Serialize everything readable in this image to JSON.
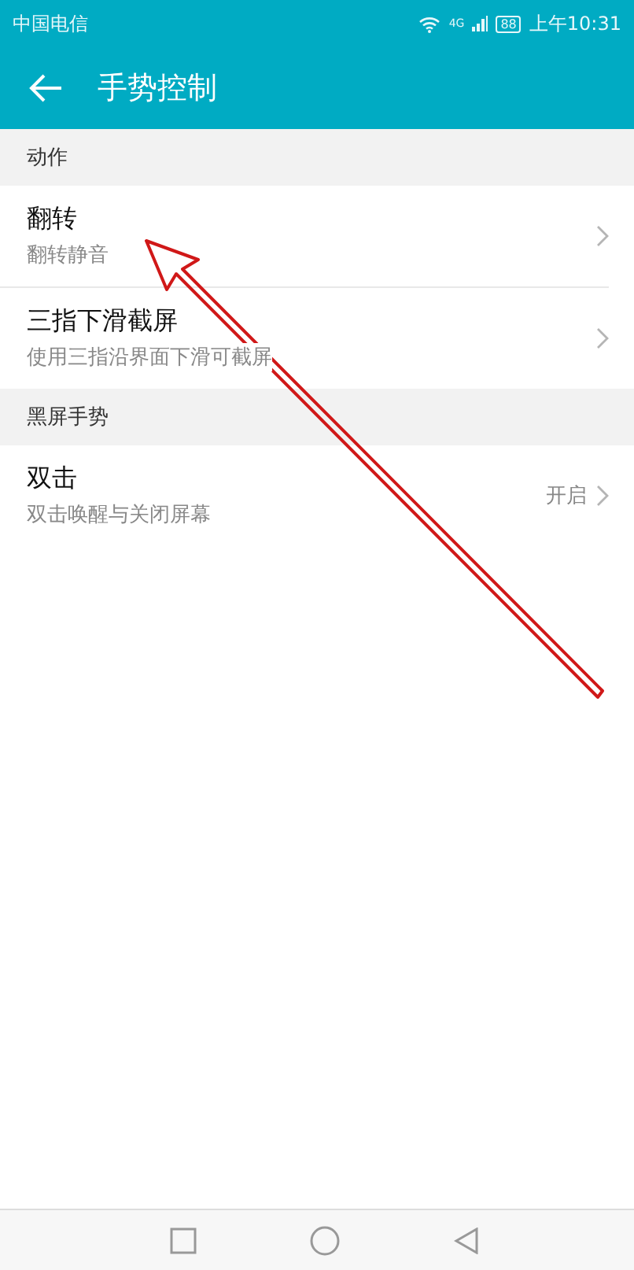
{
  "status_bar": {
    "carrier": "中国电信",
    "network": "4G",
    "battery": "88",
    "time": "上午10:31"
  },
  "toolbar": {
    "title": "手势控制"
  },
  "sections": [
    {
      "header": "动作",
      "items": [
        {
          "title": "翻转",
          "subtitle": "翻转静音"
        },
        {
          "title": "三指下滑截屏",
          "subtitle": "使用三指沿界面下滑可截屏"
        }
      ]
    },
    {
      "header": "黑屏手势",
      "items": [
        {
          "title": "双击",
          "subtitle": "双击唤醒与关闭屏幕",
          "value": "开启"
        }
      ]
    }
  ]
}
